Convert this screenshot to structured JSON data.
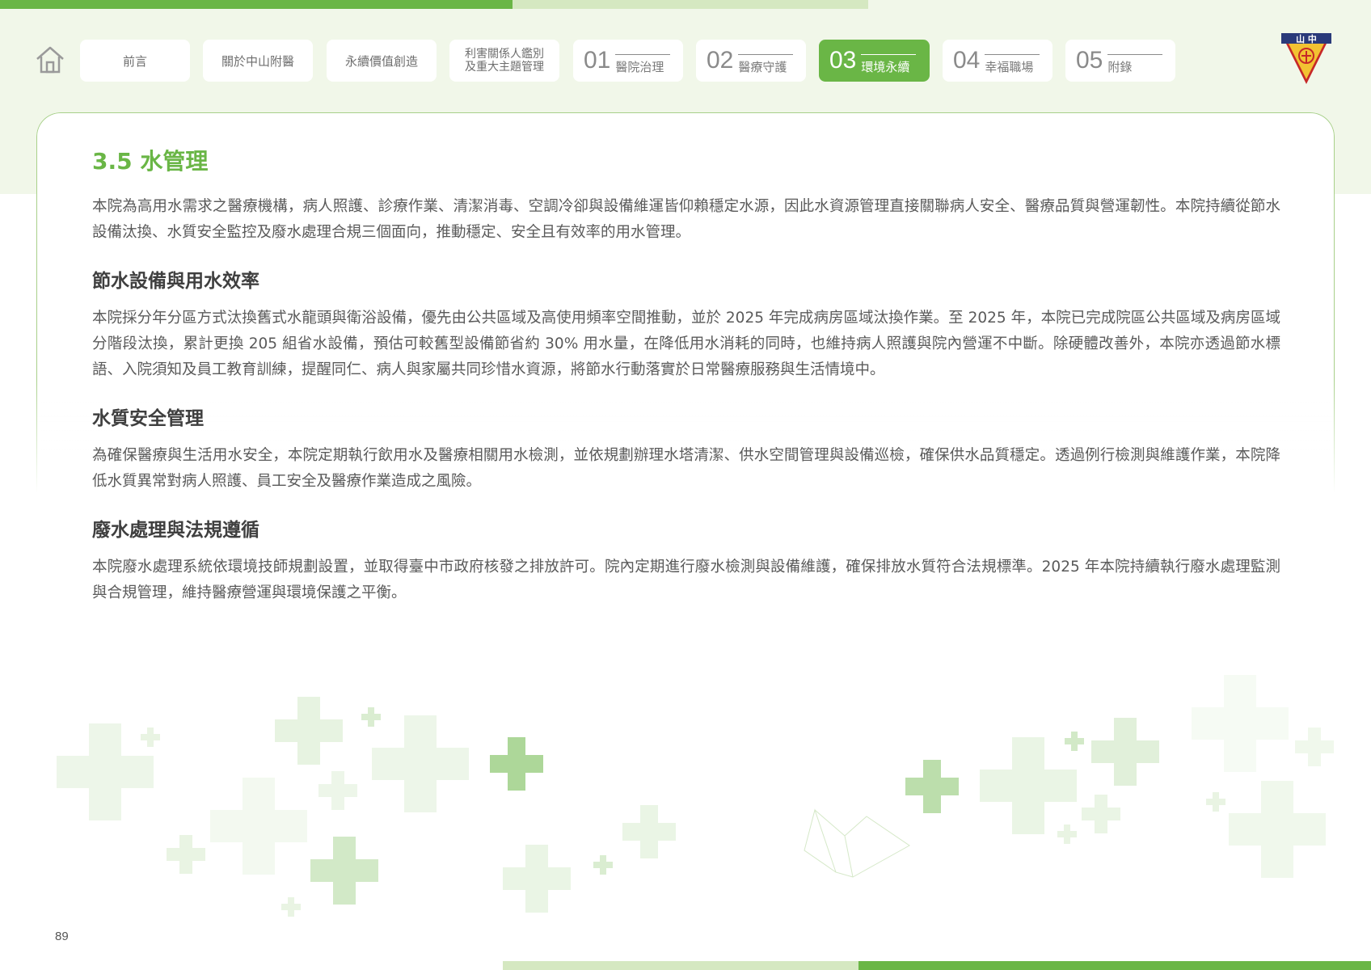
{
  "nav": {
    "tabs": [
      {
        "label": "前言"
      },
      {
        "label": "關於中山附醫"
      },
      {
        "label": "永續價值創造"
      },
      {
        "line1": "利害關係人鑑別",
        "line2": "及重大主題管理"
      },
      {
        "num": "01",
        "label": "醫院治理"
      },
      {
        "num": "02",
        "label": "醫療守護"
      },
      {
        "num": "03",
        "label": "環境永續"
      },
      {
        "num": "04",
        "label": "幸福職場"
      },
      {
        "num": "05",
        "label": "附錄"
      }
    ]
  },
  "logo": {
    "text": "山 中"
  },
  "colors": {
    "accent": "#6ab646",
    "light": "#d5e8c1",
    "band": "#f1f7e9"
  },
  "content": {
    "title": "3.5 水管理",
    "intro": "本院為高用水需求之醫療機構，病人照護、診療作業、清潔消毒、空調冷卻與設備維運皆仰賴穩定水源，因此水資源管理直接關聯病人安全、醫療品質與營運韌性。本院持續從節水設備汰換、水質安全監控及廢水處理合規三個面向，推動穩定、安全且有效率的用水管理。",
    "sections": [
      {
        "heading": "節水設備與用水效率",
        "body": "本院採分年分區方式汰換舊式水龍頭與衛浴設備，優先由公共區域及高使用頻率空間推動，並於 2025 年完成病房區域汰換作業。至 2025 年，本院已完成院區公共區域及病房區域分階段汰換，累計更換 205 組省水設備，預估可較舊型設備節省約 30% 用水量，在降低用水消耗的同時，也維持病人照護與院內營運不中斷。除硬體改善外，本院亦透過節水標語、入院須知及員工教育訓練，提醒同仁、病人與家屬共同珍惜水資源，將節水行動落實於日常醫療服務與生活情境中。"
      },
      {
        "heading": "水質安全管理",
        "body": "為確保醫療與生活用水安全，本院定期執行飲用水及醫療相關用水檢測，並依規劃辦理水塔清潔、供水空間管理與設備巡檢，確保供水品質穩定。透過例行檢測與維護作業，本院降低水質異常對病人照護、員工安全及醫療作業造成之風險。"
      },
      {
        "heading": "廢水處理與法規遵循",
        "body": "本院廢水處理系統依環境技師規劃設置，並取得臺中市政府核發之排放許可。院內定期進行廢水檢測與設備維護，確保排放水質符合法規標準。2025 年本院持續執行廢水處理監測與合規管理，維持醫療營運與環境保護之平衡。"
      }
    ]
  },
  "page_number": "89"
}
